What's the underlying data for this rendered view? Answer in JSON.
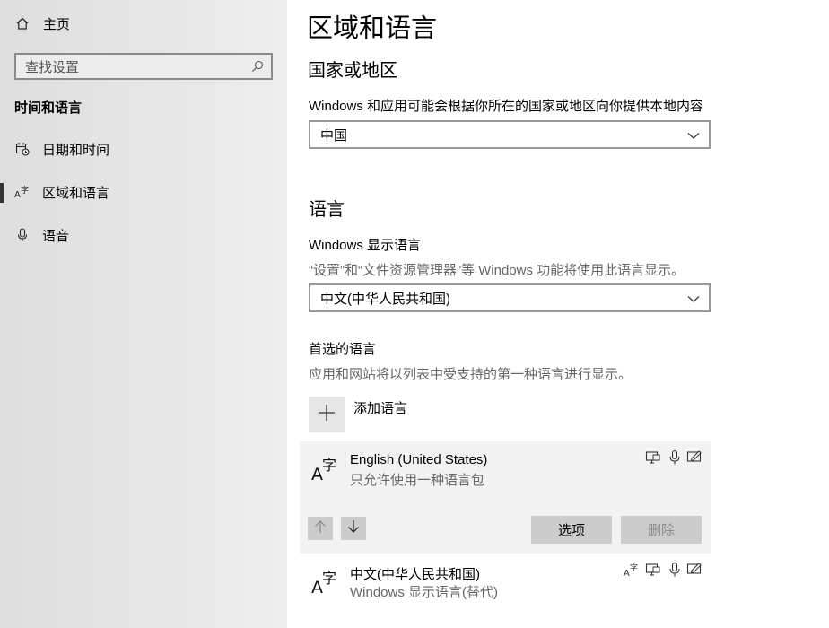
{
  "sidebar": {
    "home_label": "主页",
    "search_placeholder": "查找设置",
    "section_title": "时间和语言",
    "items": [
      {
        "label": "日期和时间",
        "icon": "calendar-clock-icon"
      },
      {
        "label": "区域和语言",
        "icon": "language-icon",
        "active": true
      },
      {
        "label": "语音",
        "icon": "microphone-icon"
      }
    ]
  },
  "main": {
    "title": "区域和语言",
    "country": {
      "heading": "国家或地区",
      "description": "Windows 和应用可能会根据你所在的国家或地区向你提供本地内容",
      "selected": "中国"
    },
    "language": {
      "heading": "语言",
      "display_label": "Windows 显示语言",
      "display_description": "“设置”和“文件资源管理器”等 Windows 功能将使用此语言显示。",
      "display_selected": "中文(中华人民共和国)",
      "preferred_label": "首选的语言",
      "preferred_description": "应用和网站将以列表中受支持的第一种语言进行显示。",
      "add_label": "添加语言",
      "entries": [
        {
          "name": "English (United States)",
          "detail": "只允许使用一种语言包"
        },
        {
          "name": "中文(中华人民共和国)",
          "detail": "Windows 显示语言(替代)"
        }
      ],
      "options_button": "选项",
      "remove_button": "删除"
    }
  },
  "colors": {
    "sidebar_bg": "#e6e6e6",
    "panel_bg": "#f2f2f2",
    "button_bg": "#cccccc"
  }
}
